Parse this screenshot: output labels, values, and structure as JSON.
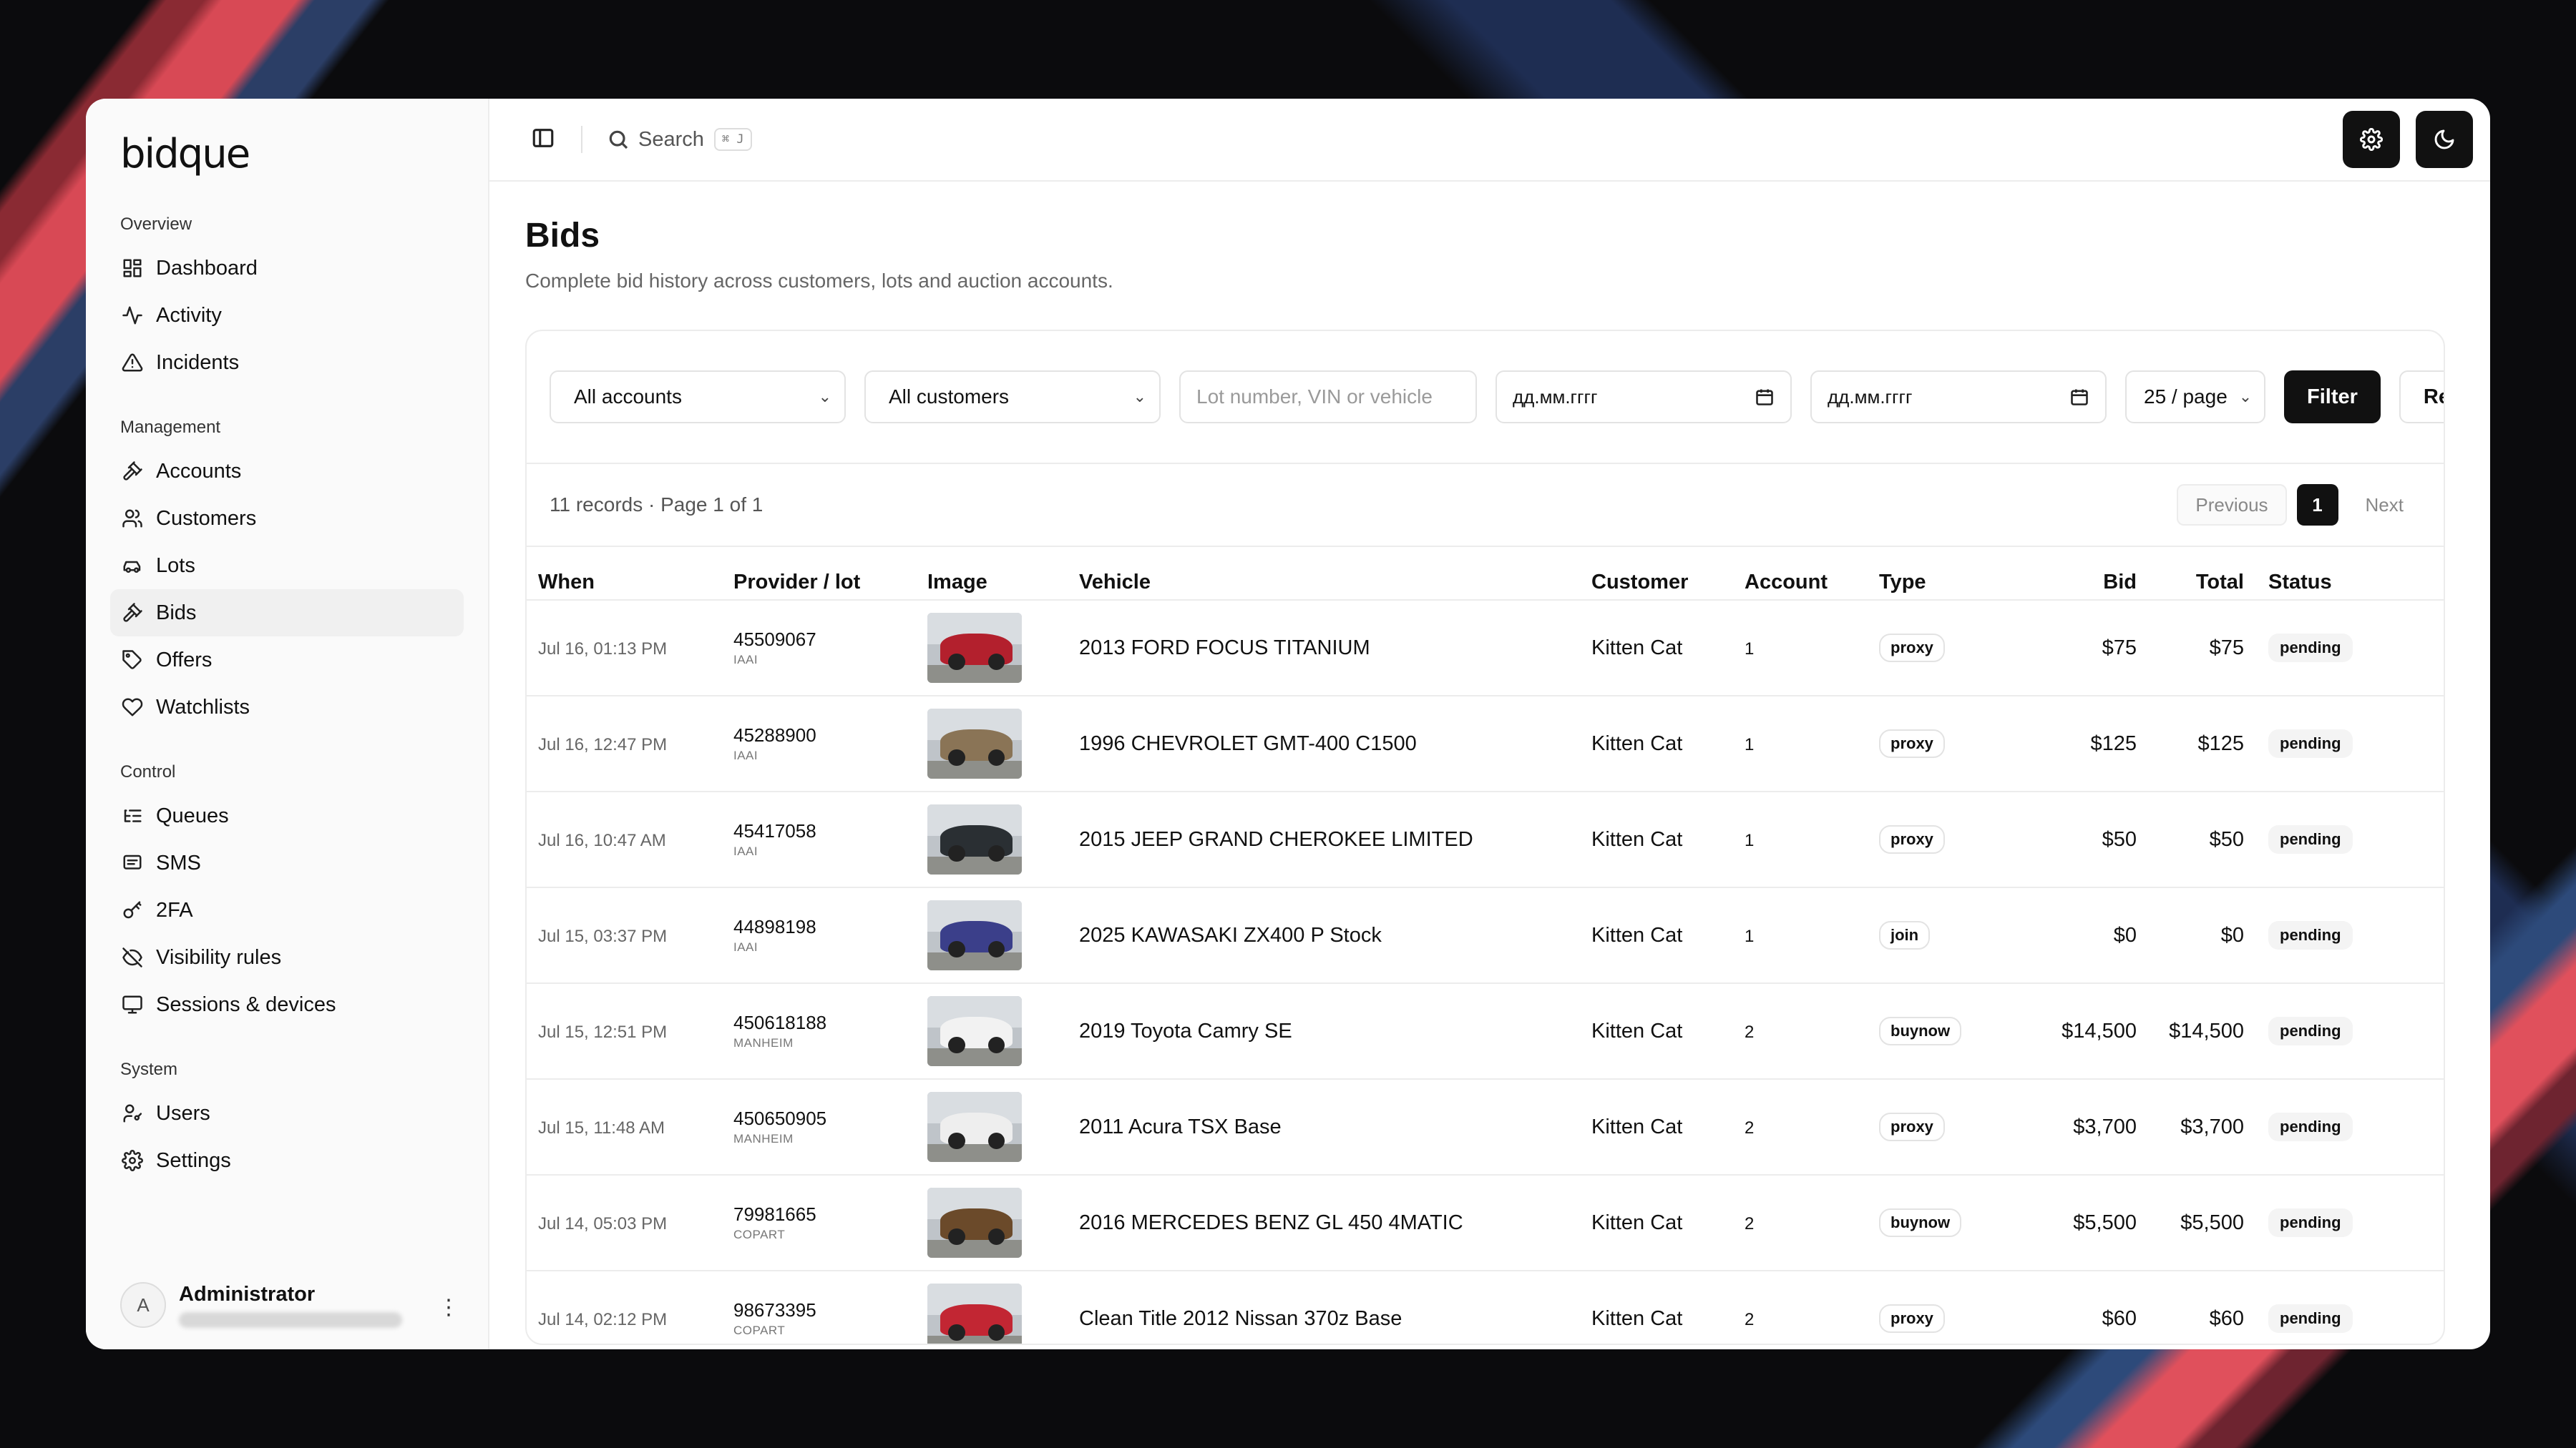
{
  "app": {
    "logo": "bidque"
  },
  "sidebar": {
    "groups": [
      {
        "label": "Overview",
        "items": [
          {
            "label": "Dashboard",
            "icon": "dashboard-icon"
          },
          {
            "label": "Activity",
            "icon": "activity-icon"
          },
          {
            "label": "Incidents",
            "icon": "warning-icon"
          }
        ]
      },
      {
        "label": "Management",
        "items": [
          {
            "label": "Accounts",
            "icon": "gavel-icon"
          },
          {
            "label": "Customers",
            "icon": "users-icon"
          },
          {
            "label": "Lots",
            "icon": "car-icon"
          },
          {
            "label": "Bids",
            "icon": "gavel-icon",
            "active": true
          },
          {
            "label": "Offers",
            "icon": "tag-icon"
          },
          {
            "label": "Watchlists",
            "icon": "heart-icon"
          }
        ]
      },
      {
        "label": "Control",
        "items": [
          {
            "label": "Queues",
            "icon": "list-icon"
          },
          {
            "label": "SMS",
            "icon": "message-icon"
          },
          {
            "label": "2FA",
            "icon": "key-icon"
          },
          {
            "label": "Visibility rules",
            "icon": "eye-off-icon"
          },
          {
            "label": "Sessions & devices",
            "icon": "monitor-icon"
          }
        ]
      },
      {
        "label": "System",
        "items": [
          {
            "label": "Users",
            "icon": "user-key-icon"
          },
          {
            "label": "Settings",
            "icon": "gear-icon"
          }
        ]
      }
    ],
    "user": {
      "initial": "A",
      "name": "Administrator"
    }
  },
  "topbar": {
    "search_label": "Search",
    "shortcut": "⌘ J"
  },
  "page": {
    "title": "Bids",
    "subtitle": "Complete bid history across customers, lots and auction accounts."
  },
  "filters": {
    "accounts": "All accounts",
    "customers": "All customers",
    "query_placeholder": "Lot number, VIN or vehicle",
    "date_from": "дд.мм.гггг",
    "date_to": "дд.мм.гггг",
    "per_page": "25 / page",
    "filter_label": "Filter",
    "reset_label": "Reset"
  },
  "pagination": {
    "summary": "11 records · Page 1 of 1",
    "previous": "Previous",
    "current": "1",
    "next": "Next"
  },
  "table": {
    "columns": [
      "When",
      "Provider / lot",
      "Image",
      "Vehicle",
      "Customer",
      "Account",
      "Type",
      "Bid",
      "Total",
      "Status"
    ],
    "rows": [
      {
        "when": "Jul 16, 01:13 PM",
        "lot": "45509067",
        "provider": "IAAI",
        "vehicle": "2013 FORD FOCUS TITANIUM",
        "customer": "Kitten Cat",
        "account": "1",
        "type": "proxy",
        "bid": "$75",
        "total": "$75",
        "status": "pending",
        "car_color": "#b3202d"
      },
      {
        "when": "Jul 16, 12:47 PM",
        "lot": "45288900",
        "provider": "IAAI",
        "vehicle": "1996 CHEVROLET GMT-400 C1500",
        "customer": "Kitten Cat",
        "account": "1",
        "type": "proxy",
        "bid": "$125",
        "total": "$125",
        "status": "pending",
        "car_color": "#8a7456"
      },
      {
        "when": "Jul 16, 10:47 AM",
        "lot": "45417058",
        "provider": "IAAI",
        "vehicle": "2015 JEEP GRAND CHEROKEE LIMITED",
        "customer": "Kitten Cat",
        "account": "1",
        "type": "proxy",
        "bid": "$50",
        "total": "$50",
        "status": "pending",
        "car_color": "#2a2f33"
      },
      {
        "when": "Jul 15, 03:37 PM",
        "lot": "44898198",
        "provider": "IAAI",
        "vehicle": "2025 KAWASAKI ZX400 P Stock",
        "customer": "Kitten Cat",
        "account": "1",
        "type": "join",
        "bid": "$0",
        "total": "$0",
        "status": "pending",
        "car_color": "#3b3f8a"
      },
      {
        "when": "Jul 15, 12:51 PM",
        "lot": "450618188",
        "provider": "MANHEIM",
        "vehicle": "2019 Toyota Camry SE",
        "customer": "Kitten Cat",
        "account": "2",
        "type": "buynow",
        "bid": "$14,500",
        "total": "$14,500",
        "status": "pending",
        "car_color": "#f2f2f2"
      },
      {
        "when": "Jul 15, 11:48 AM",
        "lot": "450650905",
        "provider": "MANHEIM",
        "vehicle": "2011 Acura TSX Base",
        "customer": "Kitten Cat",
        "account": "2",
        "type": "proxy",
        "bid": "$3,700",
        "total": "$3,700",
        "status": "pending",
        "car_color": "#eeeeee"
      },
      {
        "when": "Jul 14, 05:03 PM",
        "lot": "79981665",
        "provider": "COPART",
        "vehicle": "2016 MERCEDES BENZ GL 450 4MATIC",
        "customer": "Kitten Cat",
        "account": "2",
        "type": "buynow",
        "bid": "$5,500",
        "total": "$5,500",
        "status": "pending",
        "car_color": "#6b4a2a"
      },
      {
        "when": "Jul 14, 02:12 PM",
        "lot": "98673395",
        "provider": "COPART",
        "vehicle": "Clean Title 2012 Nissan 370z Base",
        "customer": "Kitten Cat",
        "account": "2",
        "type": "proxy",
        "bid": "$60",
        "total": "$60",
        "status": "pending",
        "car_color": "#c22633"
      }
    ]
  }
}
